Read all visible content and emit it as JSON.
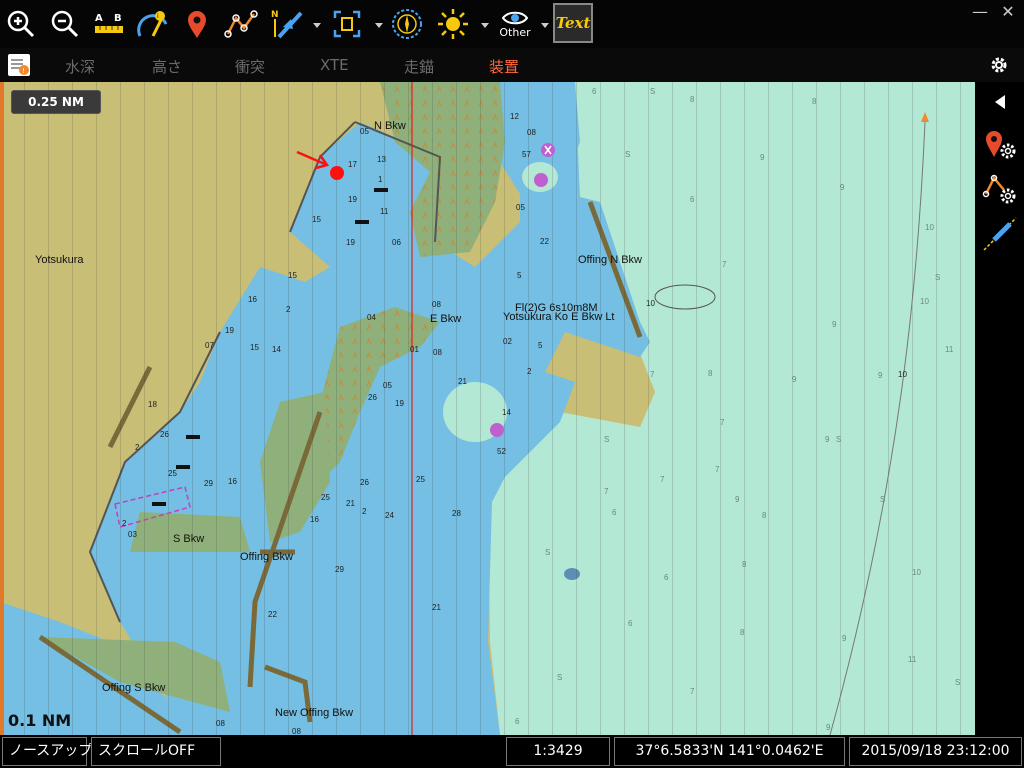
{
  "toolbar": {
    "buttons": [
      {
        "name": "zoom-in-icon"
      },
      {
        "name": "zoom-out-icon"
      },
      {
        "name": "measure-ab-icon",
        "label": "A B"
      },
      {
        "name": "info-gauge-icon"
      },
      {
        "name": "waypoint-pin-icon"
      },
      {
        "name": "route-icon"
      },
      {
        "name": "heading-compass-icon",
        "label": "N"
      },
      {
        "name": "target-frame-icon"
      },
      {
        "name": "compass-rose-icon"
      },
      {
        "name": "brightness-icon"
      },
      {
        "name": "other-eye-icon",
        "label": "Other"
      },
      {
        "name": "text-toggle-icon",
        "label": "Text"
      }
    ],
    "window_minimize": "—",
    "window_close": "✕"
  },
  "tabs": [
    {
      "label": "水深",
      "active": false
    },
    {
      "label": "高さ",
      "active": false
    },
    {
      "label": "衝突",
      "active": false
    },
    {
      "label": "XTE",
      "active": false
    },
    {
      "label": "走錨",
      "active": false
    },
    {
      "label": "装置",
      "active": true
    }
  ],
  "map": {
    "scale_badge": "0.25 NM",
    "range_label": "0.1 NM",
    "labels": {
      "n_bkw": "N Bkw",
      "yotsukura": "Yotsukura",
      "offing_n_bkw": "Offing N Bkw",
      "light_char": "Fl(2)G 6s10m8M",
      "yotsukura_ko": "Yotsukura Ko E Bkw Lt",
      "e_bkw": "E Bkw",
      "s_bkw": "S Bkw",
      "offing_bkw": "Offing Bkw",
      "offing_s_bkw": "Offing S Bkw",
      "new_offing_bkw": "New Offing Bkw"
    },
    "colors": {
      "land": "#c9be76",
      "deep_water": "#b3e8d4",
      "shallow_water": "#74bfe3",
      "vegetation": "#8fb07a",
      "track_line": "#e02020",
      "vessel_marker": "#ff1010"
    }
  },
  "statusbar": {
    "orientation": "ノースアップ",
    "scroll": "スクロールOFF",
    "scale": "1:3429",
    "position": "37°6.5833'N  141°0.0462'E",
    "datetime": "2015/09/18 23:12:00"
  }
}
